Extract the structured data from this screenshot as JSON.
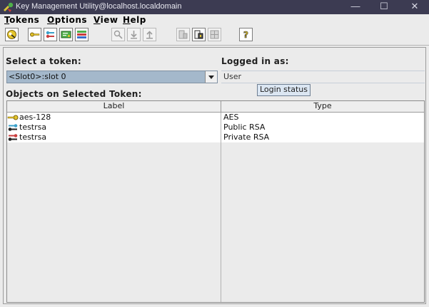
{
  "window": {
    "title": "Key Management Utility@localhost.localdomain",
    "minimize_glyph": "—",
    "maximize_glyph": "☐",
    "close_glyph": "✕"
  },
  "menubar": {
    "items": [
      {
        "accel": "T",
        "rest": "okens"
      },
      {
        "accel": "O",
        "rest": "ptions"
      },
      {
        "accel": "V",
        "rest": "iew"
      },
      {
        "accel": "H",
        "rest": "elp"
      }
    ]
  },
  "toolbar": {
    "buttons": [
      {
        "icon": "login-key-icon",
        "enabled": true
      },
      {
        "icon": "yellow-key-icon",
        "enabled": true
      },
      {
        "icon": "keypair-icon",
        "enabled": true
      },
      {
        "icon": "green-certificate-icon",
        "enabled": true
      },
      {
        "icon": "multicolor-certificate-icon",
        "enabled": true
      },
      {
        "icon": "search-key-icon",
        "enabled": false
      },
      {
        "icon": "import-icon",
        "enabled": false
      },
      {
        "icon": "export-icon",
        "enabled": false
      },
      {
        "icon": "token-info-icon",
        "enabled": false
      },
      {
        "icon": "token-login-icon",
        "enabled": true
      },
      {
        "icon": "token-grid-icon",
        "enabled": false
      },
      {
        "icon": "help-icon",
        "enabled": true
      }
    ]
  },
  "main": {
    "select_token_label": "Select a token:",
    "selected_token": "<Slot0>:slot 0",
    "logged_in_label": "Logged in as:",
    "logged_in_value": "User",
    "tooltip": "Login status",
    "objects_label": "Objects on Selected Token:",
    "table": {
      "columns": [
        "Label",
        "Type"
      ],
      "rows": [
        {
          "icon": "secret-key-icon",
          "label": "aes-128",
          "type": "AES"
        },
        {
          "icon": "public-key-icon",
          "label": "testrsa",
          "type": "Public RSA"
        },
        {
          "icon": "private-key-icon",
          "label": "testrsa",
          "type": "Private RSA"
        }
      ]
    }
  },
  "colors": {
    "titlebar": "#3c3b52",
    "combo_selected": "#a4b8cb",
    "window_bg": "#ebebeb"
  }
}
